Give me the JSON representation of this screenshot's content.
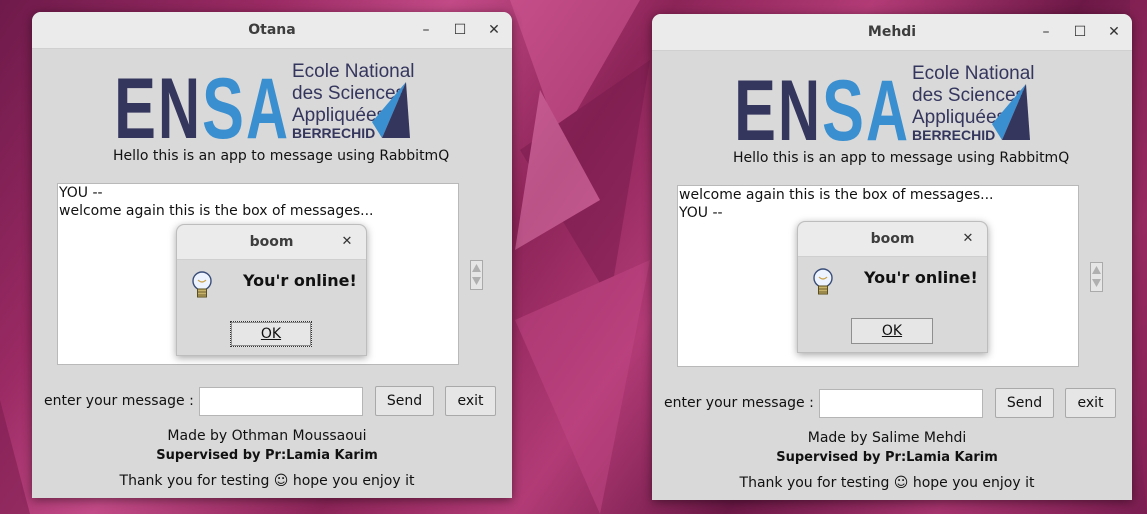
{
  "windows": [
    {
      "title": "Otana",
      "controls": {
        "minimize": "–",
        "maximize": "☐",
        "close": "✕"
      },
      "logo": {
        "letters": "ENSA",
        "line1": "Ecole Nationale",
        "line2": "des Sciences",
        "line3": "Appliquées",
        "line4": "BERRECHID"
      },
      "hello": "Hello this is an app to message using RabbitmQ",
      "messages": [
        "YOU --",
        "welcome again this is the box of messages..."
      ],
      "input_label": "enter your message :",
      "input_value": "",
      "send_label": "Send",
      "exit_label": "exit",
      "made_by": "Made by Othman Moussaoui",
      "supervised": "Supervised by Pr:Lamia Karim",
      "thanks": "Thank you for testing ☺ hope you enjoy it",
      "dialog": {
        "title": "boom",
        "close": "✕",
        "message": "You'r online!",
        "ok_label": "OK"
      }
    },
    {
      "title": "Mehdi",
      "controls": {
        "minimize": "–",
        "maximize": "☐",
        "close": "✕"
      },
      "logo": {
        "letters": "ENSA",
        "line1": "Ecole Nationale",
        "line2": "des Sciences",
        "line3": "Appliquées",
        "line4": "BERRECHID"
      },
      "hello": "Hello this is an app to message using RabbitmQ",
      "messages": [
        "welcome again this is the box of messages...",
        "YOU --"
      ],
      "input_label": "enter your message :",
      "input_value": "",
      "send_label": "Send",
      "exit_label": "exit",
      "made_by": "Made by Salime Mehdi",
      "supervised": "Supervised by Pr:Lamia Karim",
      "thanks": "Thank you for testing ☺ hope you enjoy it",
      "dialog": {
        "title": "boom",
        "close": "✕",
        "message": "You'r online!",
        "ok_label": "OK"
      }
    }
  ],
  "colors": {
    "logo_dark": "#35365e",
    "logo_blue": "#3a8fd0",
    "window_bg": "#d9d9d9",
    "desktop": "#9a2a63"
  }
}
